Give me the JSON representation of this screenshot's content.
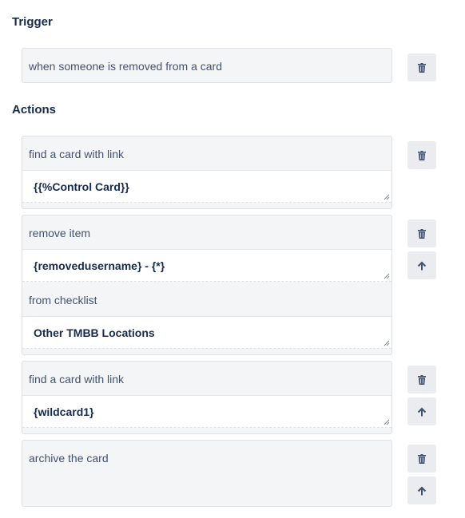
{
  "trigger": {
    "heading": "Trigger",
    "text": "when someone is removed from a card"
  },
  "actions": {
    "heading": "Actions",
    "items": [
      {
        "line1": "find a card with link",
        "field1": "{{%Control Card}}"
      },
      {
        "line1": "remove item",
        "field1": "{removedusername} - {*}",
        "line2": "from checklist",
        "field2": "Other TMBB Locations"
      },
      {
        "line1": "find a card with link",
        "field1": "{wildcard1}"
      },
      {
        "line1": "archive the card"
      }
    ]
  },
  "icons": {
    "delete": "trash-icon",
    "move_up": "arrow-up-icon"
  },
  "colors": {
    "heading": "#172b4d",
    "box_bg": "#f4f5f7",
    "button_bg": "#ebecf0",
    "icon": "#42526e"
  }
}
